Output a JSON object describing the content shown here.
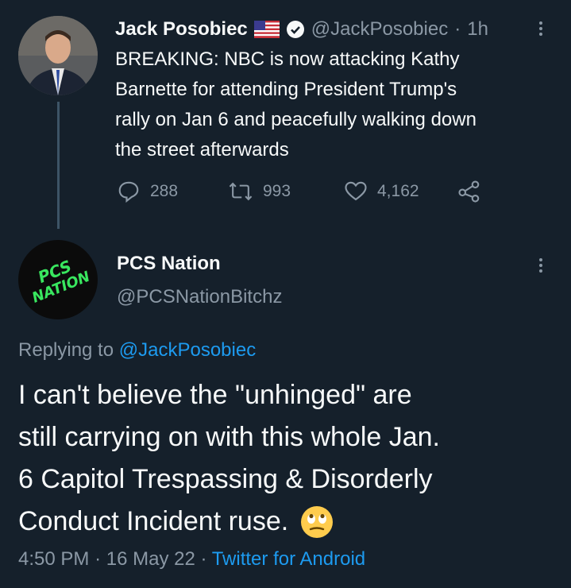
{
  "quoted_tweet": {
    "author_name": "Jack Posobiec",
    "flag": "🇺🇸",
    "handle": "@JackPosobiec",
    "separator": "·",
    "time_ago": "1h",
    "text_lines": [
      "BREAKING: NBC is now attacking Kathy",
      "Barnette for attending President Trump's",
      "rally on Jan 6 and peacefully walking down",
      "the street afterwards"
    ],
    "replies": "288",
    "retweets": "993",
    "likes": "4,162"
  },
  "reply_tweet": {
    "author_name": "PCS Nation",
    "handle": "@PCSNationBitchz",
    "avatar_text_line1": "PCS",
    "avatar_text_line2": "NATION",
    "replying_prefix": "Replying to",
    "replying_handle": "@JackPosobiec",
    "text_lines": [
      "I can't believe the \"unhinged\" are",
      "still carrying on with this whole Jan.",
      "6 Capitol Trespassing & Disorderly",
      "Conduct Incident ruse."
    ],
    "emoji": "🙄",
    "time": "4:50 PM",
    "sep1": "·",
    "date": "16 May 22",
    "sep2": "·",
    "source": "Twitter for Android"
  },
  "colors": {
    "background": "#15202b",
    "text": "#f7f9f9",
    "muted": "#8b98a5",
    "link": "#1d9bf0",
    "avatar_text": "#39e75f"
  }
}
